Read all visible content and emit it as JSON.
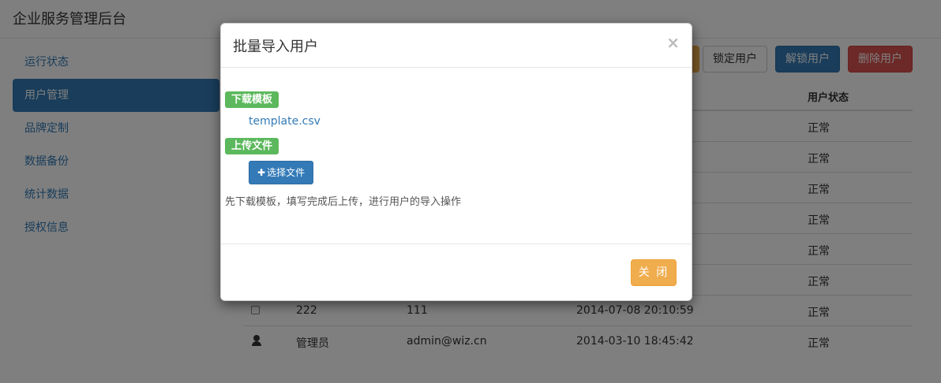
{
  "app": {
    "title": "企业服务管理后台"
  },
  "sidebar": {
    "items": [
      {
        "label": "运行状态"
      },
      {
        "label": "用户管理"
      },
      {
        "label": "品牌定制"
      },
      {
        "label": "数据备份"
      },
      {
        "label": "统计数据"
      },
      {
        "label": "授权信息"
      }
    ],
    "active_index": 1
  },
  "toolbar": {
    "lock_label": "锁定用户",
    "unlock_label": "解锁用户",
    "delete_label": "删除用户"
  },
  "table": {
    "status_header": "用户状态",
    "status_values": [
      "正常",
      "正常",
      "正常",
      "正常",
      "正常",
      "正常"
    ],
    "visible_rows": [
      {
        "icon": "checkbox",
        "name": "222",
        "account": "111",
        "time": "2014-07-08 20:10:59",
        "status": "正常"
      },
      {
        "icon": "user-icon",
        "name": "管理员",
        "account": "admin@wiz.cn",
        "time": "2014-03-10 18:45:42",
        "status": "正常"
      }
    ]
  },
  "modal": {
    "title": "批量导入用户",
    "close_symbol": "×",
    "download_label": "下载模板",
    "template_file": "template.csv",
    "upload_label": "上传文件",
    "choose_file_plus": "✚",
    "choose_file_label": "选择文件",
    "hint": "先下载模板，填写完成后上传，进行用户的导入操作",
    "close_button": "关 闭"
  },
  "colors": {
    "primary": "#337ab7",
    "success": "#5cb85c",
    "warning": "#f0ad4e",
    "danger": "#d9534f"
  }
}
